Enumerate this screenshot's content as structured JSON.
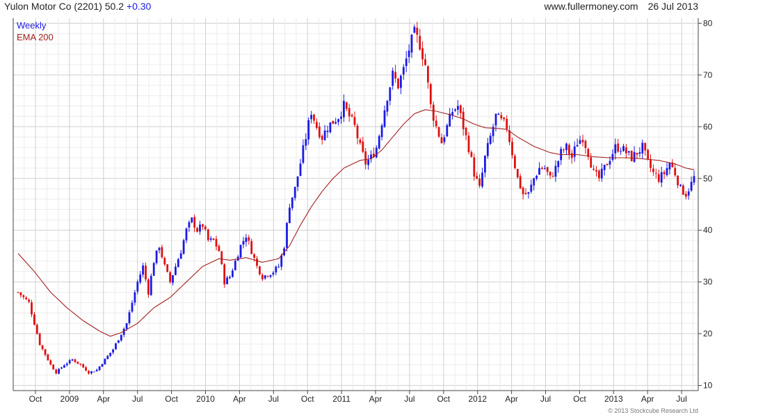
{
  "header": {
    "security": "Yulon Motor Co (2201)",
    "last": "50.2",
    "change": "+0.30",
    "site": "www.fullermoney.com",
    "date": "26 Jul 2013"
  },
  "legend": {
    "weekly": "Weekly",
    "ema": "EMA 200"
  },
  "copyright": "© 2013 Stockcube Research Ltd",
  "colors": {
    "up": "#1a1ae6",
    "down": "#e01010",
    "ema": "#a32020",
    "grid": "#d9d9d9",
    "axis": "#444444"
  },
  "chart_data": {
    "type": "candlestick",
    "yaxis": {
      "min": 9,
      "max": 81,
      "ticks": [
        10,
        20,
        30,
        40,
        50,
        60,
        70,
        80
      ],
      "position": "right"
    },
    "x_ticks": [
      "Oct",
      "2009",
      "Apr",
      "Jul",
      "Oct",
      "2010",
      "Apr",
      "Jul",
      "Oct",
      "2011",
      "Apr",
      "Jul",
      "Oct",
      "2012",
      "Apr",
      "Jul",
      "Oct",
      "2013",
      "Apr",
      "Jul"
    ],
    "grid": true,
    "price_anchors": [
      [
        0,
        28
      ],
      [
        4,
        26
      ],
      [
        6,
        22
      ],
      [
        8,
        18
      ],
      [
        10,
        16
      ],
      [
        12,
        14
      ],
      [
        14,
        12.5
      ],
      [
        17,
        14
      ],
      [
        20,
        15
      ],
      [
        23,
        14
      ],
      [
        26,
        12.5
      ],
      [
        29,
        13
      ],
      [
        32,
        15
      ],
      [
        35,
        17
      ],
      [
        38,
        20
      ],
      [
        40,
        22
      ],
      [
        42,
        26
      ],
      [
        44,
        30
      ],
      [
        46,
        33
      ],
      [
        48,
        28
      ],
      [
        50,
        34
      ],
      [
        52,
        37
      ],
      [
        54,
        33
      ],
      [
        56,
        30
      ],
      [
        58,
        33
      ],
      [
        60,
        36
      ],
      [
        62,
        40
      ],
      [
        64,
        42
      ],
      [
        66,
        40
      ],
      [
        68,
        41
      ],
      [
        70,
        38
      ],
      [
        72,
        38
      ],
      [
        74,
        36
      ],
      [
        76,
        30
      ],
      [
        78,
        31
      ],
      [
        80,
        34
      ],
      [
        82,
        37
      ],
      [
        84,
        39
      ],
      [
        86,
        36
      ],
      [
        88,
        33
      ],
      [
        90,
        31
      ],
      [
        92,
        31.5
      ],
      [
        94,
        32
      ],
      [
        96,
        33
      ],
      [
        98,
        37
      ],
      [
        100,
        45
      ],
      [
        102,
        48
      ],
      [
        104,
        53
      ],
      [
        106,
        58
      ],
      [
        108,
        63
      ],
      [
        110,
        60
      ],
      [
        112,
        58
      ],
      [
        114,
        60
      ],
      [
        116,
        61
      ],
      [
        118,
        62
      ],
      [
        120,
        64
      ],
      [
        122,
        62
      ],
      [
        124,
        60
      ],
      [
        126,
        56
      ],
      [
        128,
        53
      ],
      [
        130,
        54
      ],
      [
        132,
        56
      ],
      [
        134,
        61
      ],
      [
        136,
        66
      ],
      [
        138,
        70
      ],
      [
        140,
        68
      ],
      [
        142,
        71
      ],
      [
        144,
        75
      ],
      [
        146,
        78
      ],
      [
        148,
        76
      ],
      [
        150,
        72
      ],
      [
        152,
        64
      ],
      [
        154,
        60
      ],
      [
        156,
        57
      ],
      [
        158,
        60
      ],
      [
        160,
        63
      ],
      [
        162,
        64
      ],
      [
        164,
        60
      ],
      [
        166,
        56
      ],
      [
        168,
        51
      ],
      [
        170,
        48
      ],
      [
        172,
        54
      ],
      [
        174,
        58
      ],
      [
        176,
        62
      ],
      [
        178,
        61
      ],
      [
        180,
        60
      ],
      [
        182,
        55
      ],
      [
        184,
        50
      ],
      [
        186,
        47
      ],
      [
        188,
        47
      ],
      [
        190,
        50
      ],
      [
        192,
        52
      ],
      [
        194,
        52
      ],
      [
        196,
        50
      ],
      [
        198,
        52
      ],
      [
        200,
        55
      ],
      [
        202,
        56
      ],
      [
        204,
        54
      ],
      [
        206,
        57
      ],
      [
        208,
        58
      ],
      [
        210,
        55
      ],
      [
        212,
        51
      ],
      [
        214,
        50
      ],
      [
        216,
        52
      ],
      [
        218,
        54
      ],
      [
        220,
        56
      ],
      [
        222,
        56
      ],
      [
        224,
        55
      ],
      [
        226,
        54
      ],
      [
        228,
        55
      ],
      [
        230,
        56
      ],
      [
        232,
        53
      ],
      [
        234,
        51
      ],
      [
        236,
        50
      ],
      [
        238,
        51
      ],
      [
        240,
        53
      ],
      [
        242,
        51
      ],
      [
        244,
        48
      ],
      [
        246,
        47
      ],
      [
        248,
        49
      ],
      [
        249,
        50.2
      ]
    ],
    "ema_anchors": [
      [
        0,
        35.5
      ],
      [
        6,
        32
      ],
      [
        12,
        28
      ],
      [
        18,
        25
      ],
      [
        24,
        22.5
      ],
      [
        30,
        20.5
      ],
      [
        34,
        19.5
      ],
      [
        38,
        20.2
      ],
      [
        44,
        22
      ],
      [
        50,
        25
      ],
      [
        56,
        27
      ],
      [
        62,
        30
      ],
      [
        68,
        33
      ],
      [
        74,
        34.5
      ],
      [
        78,
        34.2
      ],
      [
        84,
        34.7
      ],
      [
        90,
        33.8
      ],
      [
        96,
        34.5
      ],
      [
        100,
        37
      ],
      [
        104,
        41
      ],
      [
        108,
        44.5
      ],
      [
        112,
        47.5
      ],
      [
        116,
        50
      ],
      [
        120,
        52
      ],
      [
        126,
        53.5
      ],
      [
        130,
        53.8
      ],
      [
        134,
        55.5
      ],
      [
        138,
        58
      ],
      [
        142,
        60.5
      ],
      [
        146,
        62.5
      ],
      [
        150,
        63.3
      ],
      [
        154,
        63
      ],
      [
        160,
        62.2
      ],
      [
        164,
        61.5
      ],
      [
        168,
        60.5
      ],
      [
        172,
        59.8
      ],
      [
        176,
        59.7
      ],
      [
        180,
        59.5
      ],
      [
        184,
        58
      ],
      [
        190,
        56.2
      ],
      [
        196,
        55
      ],
      [
        200,
        54.6
      ],
      [
        206,
        54.6
      ],
      [
        212,
        54.2
      ],
      [
        218,
        54
      ],
      [
        224,
        54
      ],
      [
        230,
        53.8
      ],
      [
        236,
        53.5
      ],
      [
        242,
        52.8
      ],
      [
        246,
        52
      ],
      [
        249,
        51.7
      ]
    ]
  }
}
